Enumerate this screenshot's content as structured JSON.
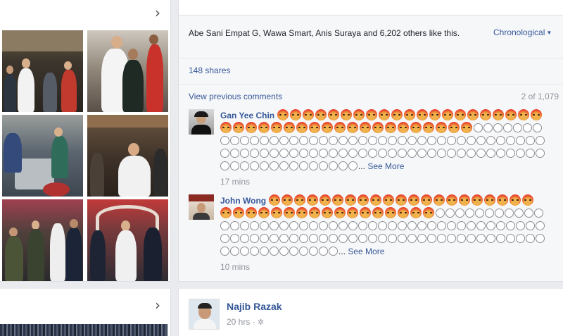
{
  "left_column": {
    "photos": [
      {
        "name": "photo-street-crowd"
      },
      {
        "name": "photo-greeting-boy"
      },
      {
        "name": "photo-market-stall"
      },
      {
        "name": "photo-shop-visit"
      },
      {
        "name": "photo-police-escort"
      },
      {
        "name": "photo-decorated-street"
      }
    ]
  },
  "post": {
    "likes_text": "Abe Sani Empat G, Wawa Smart, Anis Suraya and 6,202 others like this.",
    "sort_label": "Chronological",
    "shares": "148 shares",
    "view_previous": "View previous comments",
    "count": "2 of 1,079",
    "comments": [
      {
        "author": "Gan Yee Chin",
        "angry_count": 41,
        "neutral_count": 87,
        "see_more": "See More",
        "time": "17 mins"
      },
      {
        "author": "John Wong",
        "angry_count": 38,
        "neutral_count": 89,
        "see_more": "See More",
        "time": "10 mins"
      }
    ]
  },
  "next_post": {
    "page_name": "Najib Razak",
    "time": "20 hrs",
    "separator": "·",
    "privacy_icon": "gear-icon"
  },
  "colors": {
    "link": "#365899",
    "meta": "#90949c",
    "background": "#e9ebee",
    "angry_red": "#e8452c"
  }
}
